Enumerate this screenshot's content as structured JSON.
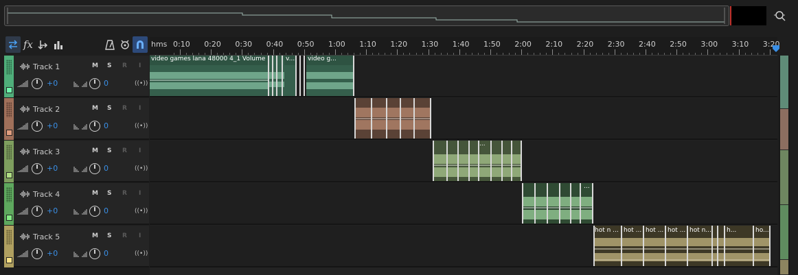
{
  "toolbar": {
    "icons": [
      "loop-swap-icon",
      "fx-icon",
      "send-icon",
      "meter-icon",
      "metronome-icon",
      "punch-icon",
      "snap-magnet-icon"
    ],
    "fx_label": "fx"
  },
  "ruler": {
    "unit_label": "hms",
    "ticks": [
      "0:10",
      "0:20",
      "0:30",
      "0:40",
      "0:50",
      "1:00",
      "1:10",
      "1:20",
      "1:30",
      "1:40",
      "1:50",
      "2:00",
      "2:10",
      "2:20",
      "2:30",
      "2:40",
      "2:50",
      "3:00",
      "3:10",
      "3:20"
    ]
  },
  "tracks": [
    {
      "name": "Track 1",
      "mute": "M",
      "solo": "S",
      "record": "R",
      "input": "I",
      "volume": "+0",
      "pan": "0",
      "color": "#4fae7a"
    },
    {
      "name": "Track 2",
      "mute": "M",
      "solo": "S",
      "record": "R",
      "input": "I",
      "volume": "+0",
      "pan": "0",
      "color": "#a0705a"
    },
    {
      "name": "Track 3",
      "mute": "M",
      "solo": "S",
      "record": "R",
      "input": "I",
      "volume": "+0",
      "pan": "0",
      "color": "#7e9e5e"
    },
    {
      "name": "Track 4",
      "mute": "M",
      "solo": "S",
      "record": "R",
      "input": "I",
      "volume": "+0",
      "pan": "0",
      "color": "#5ea85e"
    },
    {
      "name": "Track 5",
      "mute": "M",
      "solo": "S",
      "record": "R",
      "input": "I",
      "volume": "+0",
      "pan": "0",
      "color": "#b0a060"
    }
  ],
  "clips": {
    "track1": {
      "main": "video games lana 48000 4_1 Volume",
      "short": "v...",
      "second": "video g..."
    },
    "track3": {
      "dots": "..."
    },
    "track4": {
      "dots": "..."
    },
    "track5": {
      "c1": "hot n ...",
      "c2": "hot ...",
      "c3": "hot ...",
      "c4": "hot ...",
      "c5": "hot n...",
      "c6": "h...",
      "c7": "ho..."
    }
  },
  "colors": {
    "accent_blue": "#3a8fe6",
    "playhead_red": "#c0322d"
  }
}
